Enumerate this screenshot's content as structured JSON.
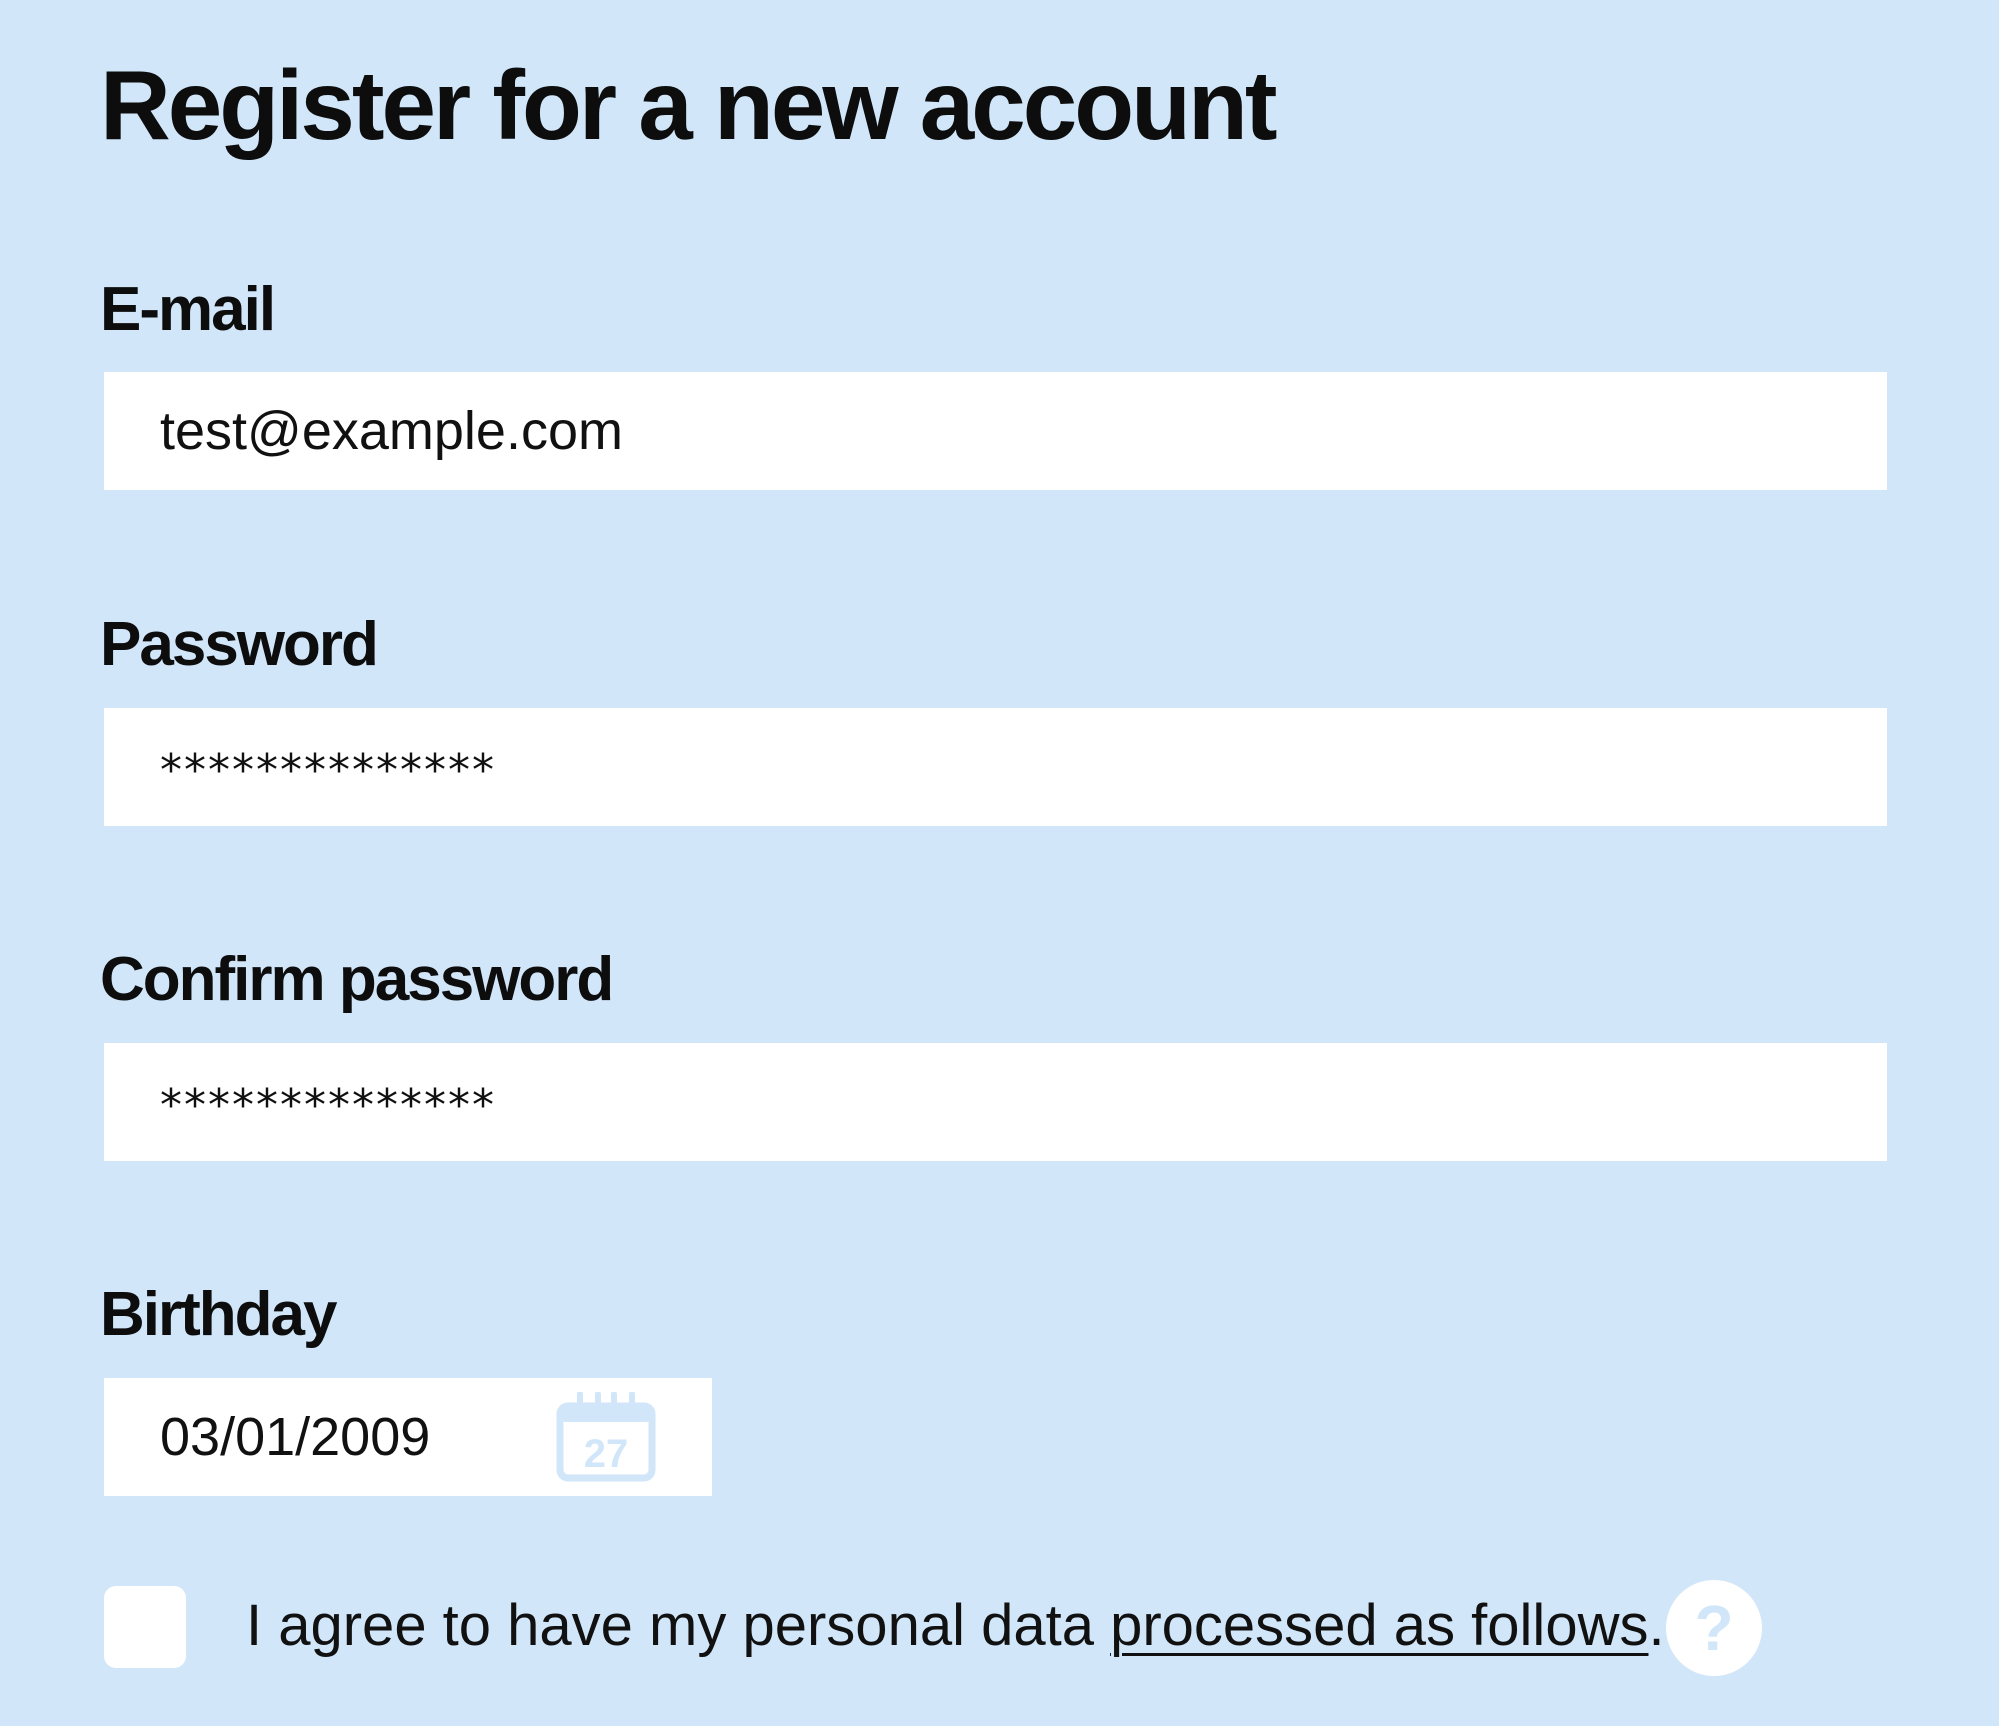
{
  "form": {
    "title": "Register for a new account",
    "email": {
      "label": "E-mail",
      "value": "test@example.com"
    },
    "password": {
      "label": "Password",
      "value": "**************"
    },
    "confirm_password": {
      "label": "Confirm password",
      "value": "**************"
    },
    "birthday": {
      "label": "Birthday",
      "value": "03/01/2009",
      "calendar_icon_day": "27",
      "icon": "calendar-icon"
    },
    "consent": {
      "checked": false,
      "text_before": "I agree to have my personal data ",
      "link_text": "processed as follows",
      "text_after": ".",
      "help_glyph": "?"
    }
  },
  "colors": {
    "background": "#d1e6f9",
    "field_background": "#ffffff",
    "text": "#111111",
    "icon_tint": "#d1e6f9"
  }
}
